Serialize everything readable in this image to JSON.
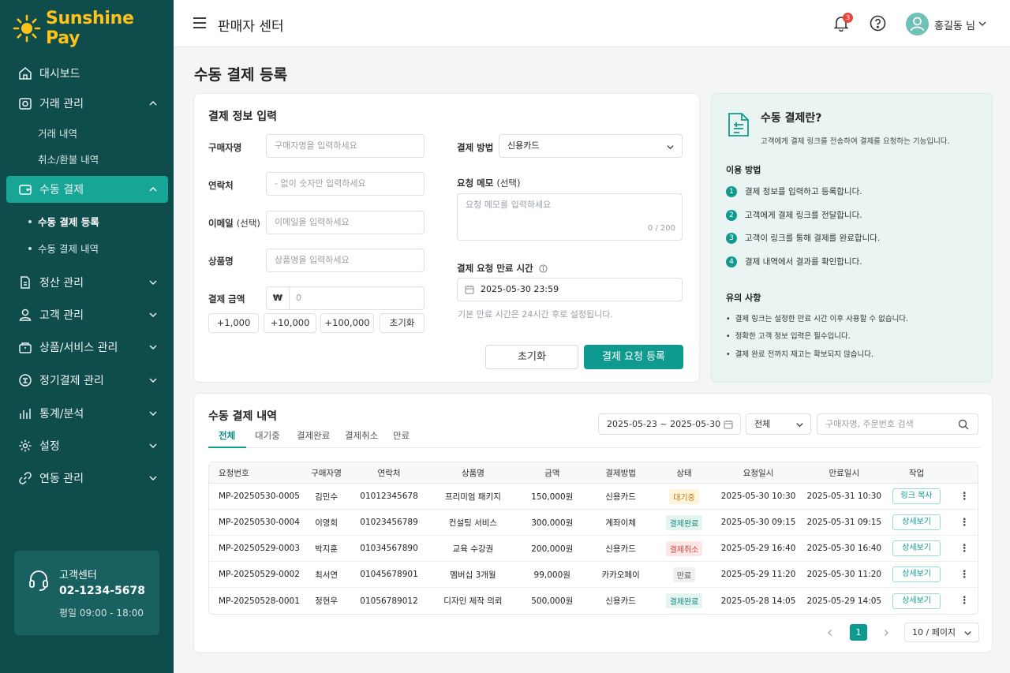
{
  "brand": {
    "name": "Sunshine Pay"
  },
  "sidebar": {
    "items": [
      {
        "label": "대시보드",
        "icon": "home-icon"
      },
      {
        "label": "거래 관리",
        "icon": "receipt-icon"
      },
      {
        "label": "수동 결제",
        "icon": "wallet-icon"
      },
      {
        "label": "정산 관리",
        "icon": "document-icon"
      },
      {
        "label": "고객 관리",
        "icon": "user-icon"
      },
      {
        "label": "상품/서비스 관리",
        "icon": "box-icon"
      },
      {
        "label": "정기결제 관리",
        "icon": "calendar-icon"
      },
      {
        "label": "통계/분석",
        "icon": "bar-chart-icon"
      },
      {
        "label": "설정",
        "icon": "gear-icon"
      },
      {
        "label": "연동 관리",
        "icon": "link-icon"
      }
    ],
    "sub_trade": [
      "거래 내역",
      "취소/환불 내역"
    ],
    "sub_manual": [
      "수동 결제 등록",
      "수동 결제 내역"
    ],
    "support": {
      "title": "고객센터",
      "phone": "02-1234-5678",
      "hours": "평일 09:00 - 18:00"
    }
  },
  "header": {
    "title": "판매자 센터",
    "notif_count": "3",
    "user": "홍길동 님"
  },
  "page_title": "수동 결제 등록",
  "form": {
    "title": "결제 정보 입력",
    "buyer_label": "구매자명",
    "buyer_placeholder": "구매자명을 입력하세요",
    "phone_label": "연락처",
    "phone_placeholder": "- 없이 숫자만 입력하세요",
    "email_label": "이메일",
    "email_optional": "(선택)",
    "email_placeholder": "이메일을 입력하세요",
    "product_label": "상품명",
    "product_placeholder": "상품명을 입력하세요",
    "amount_label": "결제 금액",
    "currency": "₩",
    "amount_placeholder": "0",
    "quick": [
      "+1,000",
      "+10,000",
      "+100,000",
      "초기화"
    ],
    "method_label": "결제 방법",
    "method_value": "신용카드",
    "memo_label": "요청 메모",
    "memo_optional": "(선택)",
    "memo_placeholder": "요청 메모를 입력하세요",
    "memo_count": "0 / 200",
    "expiry_label": "결제 요청 만료 시간",
    "expiry_value": "2025-05-30 23:59",
    "expiry_hint": "기본 만료 시간은 24시간 후로 설정됩니다.",
    "reset_button": "초기화",
    "submit_button": "결제 요청 등록"
  },
  "info": {
    "title": "수동 결제란?",
    "desc": "고객에게 결제 링크를 전송하여 결제를 요청하는 기능입니다.",
    "usage_title": "이용 방법",
    "steps": [
      {
        "num": "1",
        "text": "결제 정보를 입력하고 등록합니다."
      },
      {
        "num": "2",
        "text": "고객에게 결제 링크를 전달합니다."
      },
      {
        "num": "3",
        "text": "고객이 링크를 통해 결제를 완료합니다."
      },
      {
        "num": "4",
        "text": "결제 내역에서 결과를 확인합니다."
      }
    ],
    "notes_title": "유의 사항",
    "notes": [
      "결제 링크는 설정한 만료 시간 이후 사용할 수 없습니다.",
      "정확한 고객 정보 입력은 필수입니다.",
      "결제 완료 전까지 재고는 확보되지 않습니다."
    ]
  },
  "history": {
    "title": "수동 결제 내역",
    "tabs": [
      "전체",
      "대기중",
      "결제완료",
      "결제취소",
      "만료"
    ],
    "date_range": "2025-05-23 ~ 2025-05-30",
    "status_filter": "전체",
    "search_placeholder": "구매자명, 주문번호 검색",
    "columns": [
      "요청번호",
      "구매자명",
      "연락처",
      "상품명",
      "금액",
      "결제방법",
      "상태",
      "요청일시",
      "만료일시",
      "작업"
    ],
    "rows": [
      {
        "id": "MP-20250530-0005",
        "buyer": "김민수",
        "phone": "01012345678",
        "product": "프리미엄 패키지",
        "amount": "150,000원",
        "method": "신용카드",
        "status": "대기중",
        "requested": "2025-05-30 10:30",
        "expires": "2025-05-31 10:30",
        "action": "링크 복사"
      },
      {
        "id": "MP-20250530-0004",
        "buyer": "이영희",
        "phone": "01023456789",
        "product": "컨설팅 서비스",
        "amount": "300,000원",
        "method": "계좌이체",
        "status": "결제완료",
        "requested": "2025-05-30 09:15",
        "expires": "2025-05-31 09:15",
        "action": "상세보기"
      },
      {
        "id": "MP-20250529-0003",
        "buyer": "박지훈",
        "phone": "01034567890",
        "product": "교육 수강권",
        "amount": "200,000원",
        "method": "신용카드",
        "status": "결제취소",
        "requested": "2025-05-29 16:40",
        "expires": "2025-05-30 16:40",
        "action": "상세보기"
      },
      {
        "id": "MP-20250529-0002",
        "buyer": "최서연",
        "phone": "01045678901",
        "product": "멤버십 3개월",
        "amount": "99,000원",
        "method": "카카오페이",
        "status": "만료",
        "requested": "2025-05-29 11:20",
        "expires": "2025-05-30 11:20",
        "action": "상세보기"
      },
      {
        "id": "MP-20250528-0001",
        "buyer": "정현우",
        "phone": "01056789012",
        "product": "디자인 제작 의뢰",
        "amount": "500,000원",
        "method": "신용카드",
        "status": "결제완료",
        "requested": "2025-05-28 14:05",
        "expires": "2025-05-29 14:05",
        "action": "상세보기"
      }
    ],
    "status_colors": {
      "대기중": {
        "bg": "#fff4dc",
        "fg": "#b9770e"
      },
      "결제완료": {
        "bg": "#e4f5f1",
        "fg": "#148a7d"
      },
      "결제취소": {
        "bg": "#fde7e6",
        "fg": "#d0433a"
      },
      "만료": {
        "bg": "#eeeff1",
        "fg": "#555555"
      }
    },
    "page": "1",
    "per_page": "10 / 페이지"
  },
  "colors": {
    "sidebar": "#0f4c4c",
    "accent": "#0f9a90",
    "brand": "#ffc21a"
  }
}
